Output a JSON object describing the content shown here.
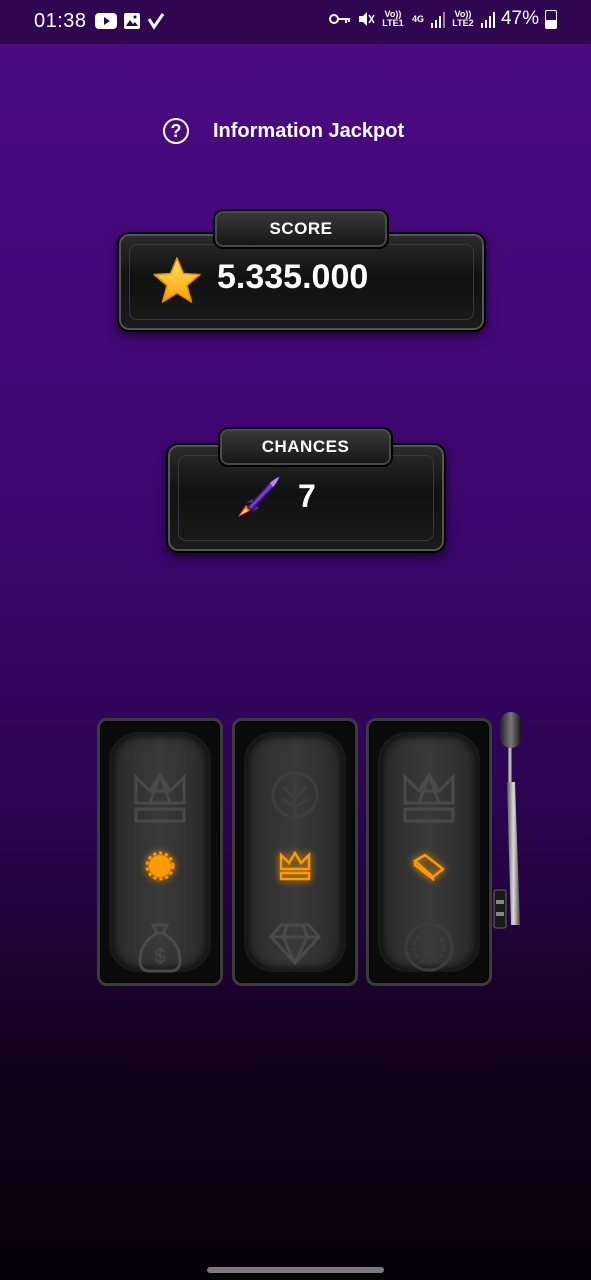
{
  "status_bar": {
    "time": "01:38",
    "net1": "Vo)) LTE1",
    "net_type": "4G",
    "net2": "Vo)) LTE2",
    "battery": "47%"
  },
  "header": {
    "help_icon": "?",
    "title": "Information Jackpot"
  },
  "score": {
    "label": "SCORE",
    "value": "5.335.000",
    "icon": "star-icon"
  },
  "chances": {
    "label": "CHANCES",
    "value": "7",
    "icon": "rocket-icon"
  },
  "slots": {
    "reels": [
      {
        "top": "crown-icon",
        "middle": "gear-icon",
        "bottom": "money-bag-icon"
      },
      {
        "top": "tree-icon",
        "middle": "crown-icon",
        "bottom": "diamond-icon"
      },
      {
        "top": "crown-icon",
        "middle": "gold-bar-icon",
        "bottom": "coin-icon"
      }
    ],
    "highlight_color": "#ff9a00"
  }
}
